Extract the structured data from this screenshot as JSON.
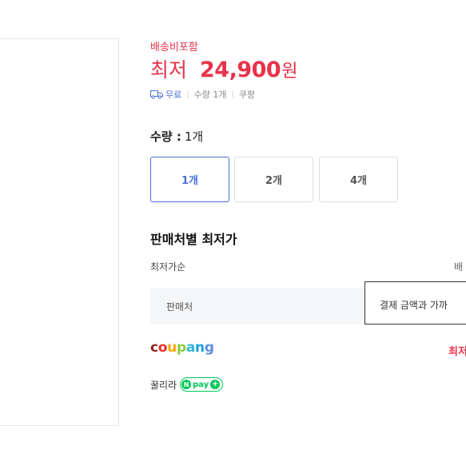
{
  "product": {
    "shipping_note": "배송비포함",
    "price_label": "최저",
    "price_value": "24,900",
    "price_unit": "원",
    "meta": {
      "shipping": "무료",
      "quantity": "수량 1개",
      "mall": "쿠팡"
    }
  },
  "quantity": {
    "title": "수량 :",
    "selected": "1개",
    "options": [
      "1개",
      "2개",
      "4개"
    ]
  },
  "sellers": {
    "title": "판매처별 최저가",
    "filter_label": "최저가순",
    "filter_right": "배",
    "header_seller": "판매처",
    "tooltip": "결제 금액과 가까",
    "rows": [
      {
        "name": "coupang",
        "price": "최저",
        "logo_letters": [
          "c",
          "o",
          "u",
          "p",
          "a",
          "n",
          "g"
        ],
        "logo_colors": [
          "#8b2a1f",
          "#e62b27",
          "#f7a600",
          "#8ccb3f",
          "#2eb7d6",
          "#19a0dd",
          "#5f8ed8"
        ]
      },
      {
        "name": "꿀리라",
        "badge": "pay",
        "badge_icon": "N"
      }
    ]
  },
  "icons": {
    "truck": "truck-icon",
    "npay": "npay-badge-icon"
  }
}
